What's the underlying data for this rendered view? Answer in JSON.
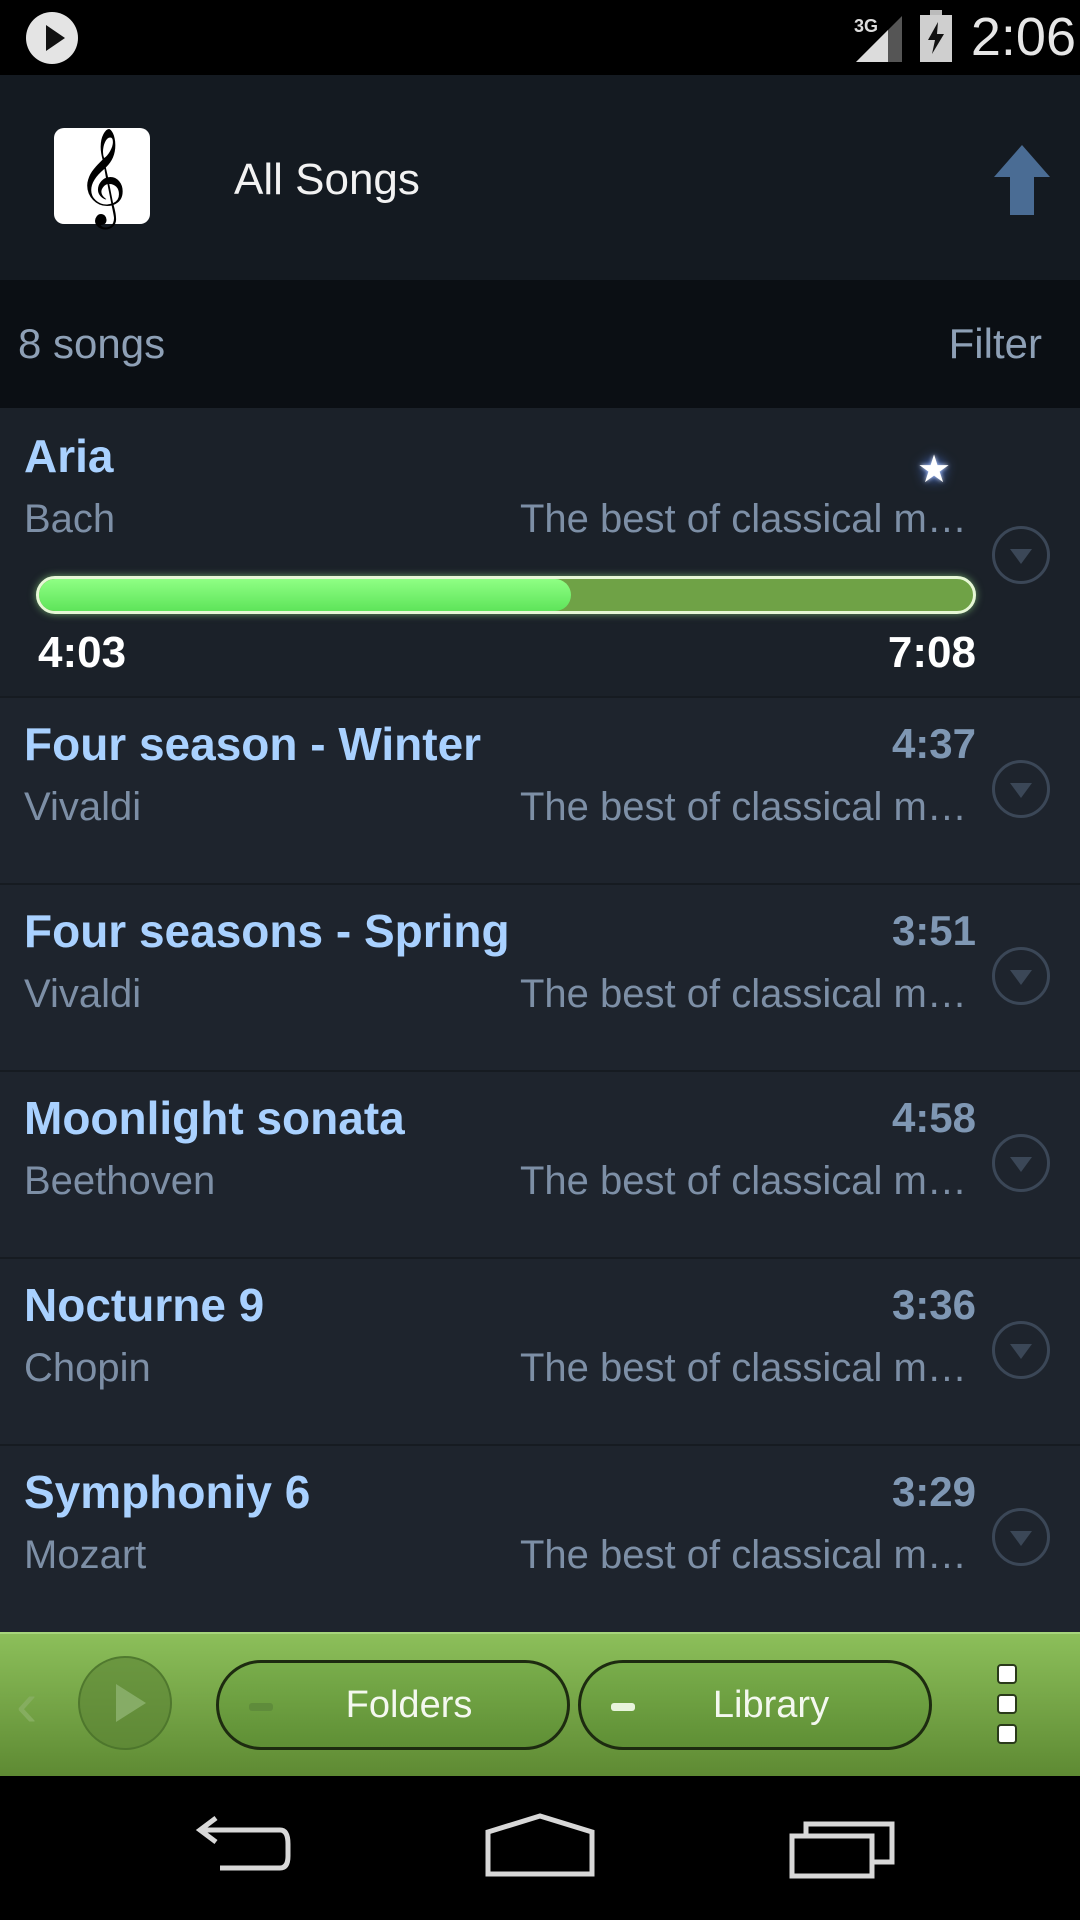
{
  "status_bar": {
    "network_label": "3G",
    "time": "2:06",
    "icons": [
      "play-icon",
      "signal-icon",
      "battery-charging-icon"
    ]
  },
  "action_bar": {
    "title": "All Songs",
    "logo_icon": "treble-clef-icon",
    "up_icon": "up-arrow-icon"
  },
  "sub_header": {
    "count": "8 songs",
    "filter_label": "Filter"
  },
  "now_playing": {
    "title": "Aria",
    "artist": "Bach",
    "album": "The best of classical music",
    "elapsed": "4:03",
    "total": "7:08",
    "progress_fraction": 0.57,
    "starred": true
  },
  "songs": [
    {
      "title": "Four season - Winter",
      "artist": "Vivaldi",
      "album": "The best of classical music",
      "duration": "4:37"
    },
    {
      "title": "Four seasons - Spring",
      "artist": "Vivaldi",
      "album": "The best of classical music",
      "duration": "3:51"
    },
    {
      "title": "Moonlight sonata",
      "artist": "Beethoven",
      "album": "The best of classical music",
      "duration": "4:58"
    },
    {
      "title": "Nocturne 9",
      "artist": "Chopin",
      "album": "The best of classical music",
      "duration": "3:36"
    },
    {
      "title": "Symphoniy 6",
      "artist": "Mozart",
      "album": "The best of classical music",
      "duration": "3:29"
    }
  ],
  "bottom_bar": {
    "folders_label": "Folders",
    "library_label": "Library"
  },
  "colors": {
    "accent_green": "#7fe86a",
    "title_blue": "#a9d1ff",
    "list_bg": "#1e242d"
  }
}
